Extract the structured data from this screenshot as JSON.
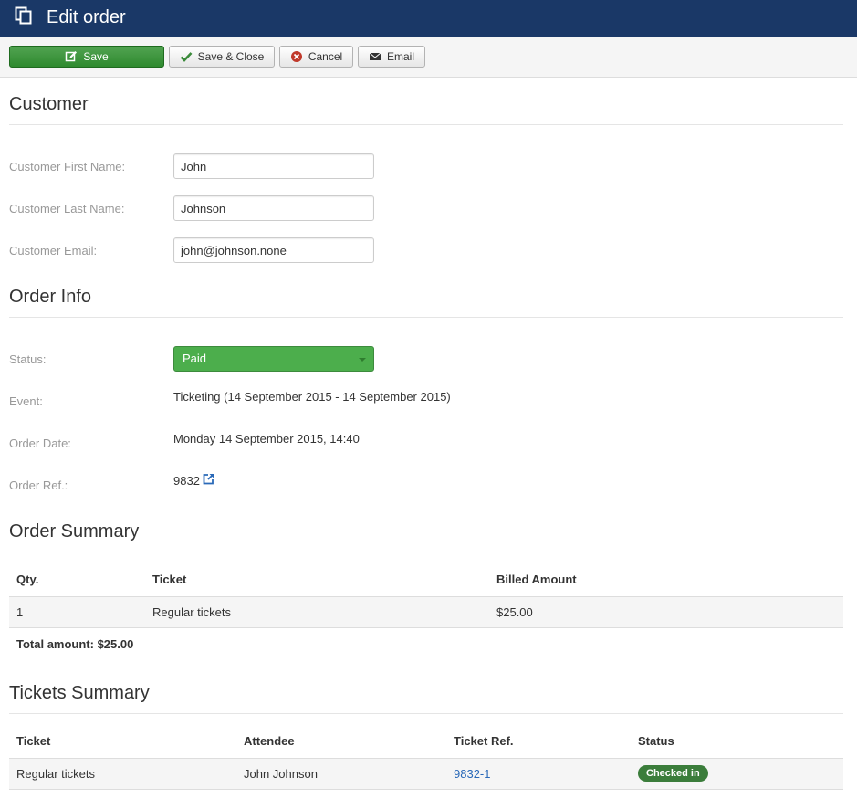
{
  "header": {
    "title": "Edit order",
    "icon": "copy-icon"
  },
  "toolbar": {
    "save_label": "Save",
    "save_close_label": "Save & Close",
    "cancel_label": "Cancel",
    "email_label": "Email"
  },
  "customer": {
    "section_title": "Customer",
    "first_name_label": "Customer First Name:",
    "first_name": "John",
    "last_name_label": "Customer Last Name:",
    "last_name": "Johnson",
    "email_label": "Customer Email:",
    "email": "john@johnson.none"
  },
  "order_info": {
    "section_title": "Order Info",
    "status_label": "Status:",
    "status": "Paid",
    "event_label": "Event:",
    "event": "Ticketing (14 September 2015 - 14 September 2015)",
    "order_date_label": "Order Date:",
    "order_date": "Monday 14 September 2015, 14:40",
    "order_ref_label": "Order Ref.:",
    "order_ref": "9832"
  },
  "order_summary": {
    "section_title": "Order Summary",
    "columns": [
      "Qty.",
      "Ticket",
      "Billed Amount"
    ],
    "rows": [
      {
        "qty": "1",
        "ticket": "Regular tickets",
        "amount": "$25.00"
      }
    ],
    "total": "Total amount: $25.00"
  },
  "tickets_summary": {
    "section_title": "Tickets Summary",
    "columns": [
      "Ticket",
      "Attendee",
      "Ticket Ref.",
      "Status"
    ],
    "rows": [
      {
        "ticket": "Regular tickets",
        "attendee": "John Johnson",
        "ref": "9832-1",
        "status": "Checked in"
      }
    ]
  },
  "colors": {
    "header_bg": "#1a3867",
    "save_green": "#4cae4c",
    "link_blue": "#2a69b8",
    "badge_green": "#3b7d3b"
  }
}
